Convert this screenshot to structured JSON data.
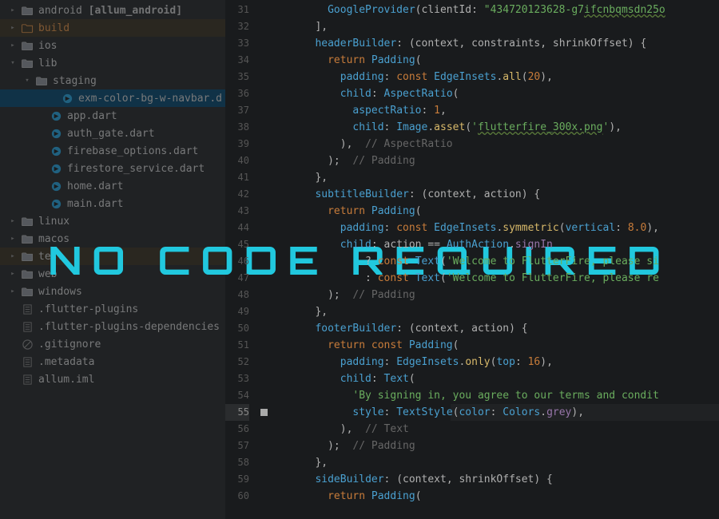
{
  "sidebar": {
    "items": [
      {
        "indent": 0,
        "chev": "right",
        "iconType": "folder",
        "label": "android",
        "suffix": " [allum_android]",
        "highlighted": false
      },
      {
        "indent": 0,
        "chev": "right",
        "iconType": "folder-excl",
        "label": "build",
        "orange": true,
        "highlighted": true
      },
      {
        "indent": 0,
        "chev": "right",
        "iconType": "folder",
        "label": "ios"
      },
      {
        "indent": 0,
        "chev": "down",
        "iconType": "folder",
        "label": "lib"
      },
      {
        "indent": 1,
        "chev": "down",
        "iconType": "folder",
        "label": "staging"
      },
      {
        "indent": 3,
        "chev": "",
        "iconType": "dart",
        "label": "exm-color-bg-w-navbar.d",
        "selected": true
      },
      {
        "indent": 2,
        "chev": "",
        "iconType": "dart",
        "label": "app.dart"
      },
      {
        "indent": 2,
        "chev": "",
        "iconType": "dart",
        "label": "auth_gate.dart"
      },
      {
        "indent": 2,
        "chev": "",
        "iconType": "dart",
        "label": "firebase_options.dart"
      },
      {
        "indent": 2,
        "chev": "",
        "iconType": "dart",
        "label": "firestore_service.dart"
      },
      {
        "indent": 2,
        "chev": "",
        "iconType": "dart",
        "label": "home.dart"
      },
      {
        "indent": 2,
        "chev": "",
        "iconType": "dart",
        "label": "main.dart"
      },
      {
        "indent": 0,
        "chev": "right",
        "iconType": "folder",
        "label": "linux"
      },
      {
        "indent": 0,
        "chev": "right",
        "iconType": "folder",
        "label": "macos"
      },
      {
        "indent": 0,
        "chev": "right",
        "iconType": "folder",
        "label": "test",
        "highlighted": true
      },
      {
        "indent": 0,
        "chev": "right",
        "iconType": "folder",
        "label": "web"
      },
      {
        "indent": 0,
        "chev": "right",
        "iconType": "folder",
        "label": "windows"
      },
      {
        "indent": 0,
        "chev": "",
        "iconType": "file",
        "label": ".flutter-plugins"
      },
      {
        "indent": 0,
        "chev": "",
        "iconType": "file",
        "label": ".flutter-plugins-dependencies"
      },
      {
        "indent": 0,
        "chev": "",
        "iconType": "ignore",
        "label": ".gitignore"
      },
      {
        "indent": 0,
        "chev": "",
        "iconType": "file",
        "label": ".metadata"
      },
      {
        "indent": 0,
        "chev": "",
        "iconType": "file",
        "label": "allum.iml"
      }
    ]
  },
  "editor": {
    "startLine": 31,
    "currentLine": 55,
    "lines": [
      {
        "n": 31,
        "tokens": [
          {
            "t": "           ",
            "c": "c-txt"
          },
          {
            "t": "GoogleProvider",
            "c": "c-type"
          },
          {
            "t": "(clientId: ",
            "c": "c-txt"
          },
          {
            "t": "\"434720123628-g7",
            "c": "c-str"
          },
          {
            "t": "ifcnbqmsdn25o",
            "c": "c-str c-wavy"
          }
        ]
      },
      {
        "n": 32,
        "tokens": [
          {
            "t": "         ],",
            "c": "c-txt"
          }
        ]
      },
      {
        "n": 33,
        "tokens": [
          {
            "t": "         ",
            "c": "c-txt"
          },
          {
            "t": "headerBuilder",
            "c": "c-param"
          },
          {
            "t": ": (context, constraints, shrinkOffset) {",
            "c": "c-txt"
          }
        ]
      },
      {
        "n": 34,
        "tokens": [
          {
            "t": "           ",
            "c": "c-txt"
          },
          {
            "t": "return ",
            "c": "c-kw"
          },
          {
            "t": "Padding",
            "c": "c-type"
          },
          {
            "t": "(",
            "c": "c-txt"
          }
        ]
      },
      {
        "n": 35,
        "tokens": [
          {
            "t": "             ",
            "c": "c-txt"
          },
          {
            "t": "padding",
            "c": "c-param"
          },
          {
            "t": ": ",
            "c": "c-txt"
          },
          {
            "t": "const ",
            "c": "c-kw"
          },
          {
            "t": "EdgeInsets",
            "c": "c-type"
          },
          {
            "t": ".",
            "c": "c-txt"
          },
          {
            "t": "all",
            "c": "c-method"
          },
          {
            "t": "(",
            "c": "c-txt"
          },
          {
            "t": "20",
            "c": "c-num"
          },
          {
            "t": "),",
            "c": "c-txt"
          }
        ]
      },
      {
        "n": 36,
        "tokens": [
          {
            "t": "             ",
            "c": "c-txt"
          },
          {
            "t": "child",
            "c": "c-param"
          },
          {
            "t": ": ",
            "c": "c-txt"
          },
          {
            "t": "AspectRatio",
            "c": "c-type"
          },
          {
            "t": "(",
            "c": "c-txt"
          }
        ]
      },
      {
        "n": 37,
        "tokens": [
          {
            "t": "               ",
            "c": "c-txt"
          },
          {
            "t": "aspectRatio",
            "c": "c-param"
          },
          {
            "t": ": ",
            "c": "c-txt"
          },
          {
            "t": "1",
            "c": "c-num"
          },
          {
            "t": ",",
            "c": "c-txt"
          }
        ]
      },
      {
        "n": 38,
        "tokens": [
          {
            "t": "               ",
            "c": "c-txt"
          },
          {
            "t": "child",
            "c": "c-param"
          },
          {
            "t": ": ",
            "c": "c-txt"
          },
          {
            "t": "Image",
            "c": "c-type"
          },
          {
            "t": ".",
            "c": "c-txt"
          },
          {
            "t": "asset",
            "c": "c-method"
          },
          {
            "t": "(",
            "c": "c-txt"
          },
          {
            "t": "'",
            "c": "c-str"
          },
          {
            "t": "flutterfire_300x.png",
            "c": "c-str c-wavy"
          },
          {
            "t": "'",
            "c": "c-str"
          },
          {
            "t": "),",
            "c": "c-txt"
          }
        ]
      },
      {
        "n": 39,
        "tokens": [
          {
            "t": "             ),  ",
            "c": "c-txt"
          },
          {
            "t": "// AspectRatio",
            "c": "c-comment"
          }
        ]
      },
      {
        "n": 40,
        "tokens": [
          {
            "t": "           );  ",
            "c": "c-txt"
          },
          {
            "t": "// Padding",
            "c": "c-comment"
          }
        ]
      },
      {
        "n": 41,
        "tokens": [
          {
            "t": "         },",
            "c": "c-txt"
          }
        ]
      },
      {
        "n": 42,
        "tokens": [
          {
            "t": "         ",
            "c": "c-txt"
          },
          {
            "t": "subtitleBuilder",
            "c": "c-param"
          },
          {
            "t": ": (context, action) {",
            "c": "c-txt"
          }
        ]
      },
      {
        "n": 43,
        "tokens": [
          {
            "t": "           ",
            "c": "c-txt"
          },
          {
            "t": "return ",
            "c": "c-kw"
          },
          {
            "t": "Padding",
            "c": "c-type"
          },
          {
            "t": "(",
            "c": "c-txt"
          }
        ]
      },
      {
        "n": 44,
        "tokens": [
          {
            "t": "             ",
            "c": "c-txt"
          },
          {
            "t": "padding",
            "c": "c-param"
          },
          {
            "t": ": ",
            "c": "c-txt"
          },
          {
            "t": "const ",
            "c": "c-kw"
          },
          {
            "t": "EdgeInsets",
            "c": "c-type"
          },
          {
            "t": ".",
            "c": "c-txt"
          },
          {
            "t": "symmetric",
            "c": "c-method"
          },
          {
            "t": "(",
            "c": "c-txt"
          },
          {
            "t": "vertical",
            "c": "c-param"
          },
          {
            "t": ": ",
            "c": "c-txt"
          },
          {
            "t": "8.0",
            "c": "c-num"
          },
          {
            "t": "),",
            "c": "c-txt"
          }
        ]
      },
      {
        "n": 45,
        "tokens": [
          {
            "t": "             ",
            "c": "c-txt"
          },
          {
            "t": "child",
            "c": "c-param"
          },
          {
            "t": ": action == ",
            "c": "c-txt"
          },
          {
            "t": "AuthAction",
            "c": "c-type"
          },
          {
            "t": ".",
            "c": "c-txt"
          },
          {
            "t": "signIn",
            "c": "c-prop"
          }
        ]
      },
      {
        "n": 46,
        "tokens": [
          {
            "t": "                 ? ",
            "c": "c-txt"
          },
          {
            "t": "const ",
            "c": "c-kw"
          },
          {
            "t": "Text",
            "c": "c-type"
          },
          {
            "t": "(",
            "c": "c-txt"
          },
          {
            "t": "'Welcome to FlutterFire, please si",
            "c": "c-str"
          }
        ]
      },
      {
        "n": 47,
        "tokens": [
          {
            "t": "                 : ",
            "c": "c-txt"
          },
          {
            "t": "const ",
            "c": "c-kw"
          },
          {
            "t": "Text",
            "c": "c-type"
          },
          {
            "t": "(",
            "c": "c-txt"
          },
          {
            "t": "'Welcome to FlutterFire, please re",
            "c": "c-str"
          }
        ]
      },
      {
        "n": 48,
        "tokens": [
          {
            "t": "           );  ",
            "c": "c-txt"
          },
          {
            "t": "// Padding",
            "c": "c-comment"
          }
        ]
      },
      {
        "n": 49,
        "tokens": [
          {
            "t": "         },",
            "c": "c-txt"
          }
        ]
      },
      {
        "n": 50,
        "tokens": [
          {
            "t": "         ",
            "c": "c-txt"
          },
          {
            "t": "footerBuilder",
            "c": "c-param"
          },
          {
            "t": ": (context, action) {",
            "c": "c-txt"
          }
        ]
      },
      {
        "n": 51,
        "tokens": [
          {
            "t": "           ",
            "c": "c-txt"
          },
          {
            "t": "return const ",
            "c": "c-kw"
          },
          {
            "t": "Padding",
            "c": "c-type"
          },
          {
            "t": "(",
            "c": "c-txt"
          }
        ]
      },
      {
        "n": 52,
        "tokens": [
          {
            "t": "             ",
            "c": "c-txt"
          },
          {
            "t": "padding",
            "c": "c-param"
          },
          {
            "t": ": ",
            "c": "c-txt"
          },
          {
            "t": "EdgeInsets",
            "c": "c-type"
          },
          {
            "t": ".",
            "c": "c-txt"
          },
          {
            "t": "only",
            "c": "c-method"
          },
          {
            "t": "(",
            "c": "c-txt"
          },
          {
            "t": "top",
            "c": "c-param"
          },
          {
            "t": ": ",
            "c": "c-txt"
          },
          {
            "t": "16",
            "c": "c-num"
          },
          {
            "t": "),",
            "c": "c-txt"
          }
        ]
      },
      {
        "n": 53,
        "tokens": [
          {
            "t": "             ",
            "c": "c-txt"
          },
          {
            "t": "child",
            "c": "c-param"
          },
          {
            "t": ": ",
            "c": "c-txt"
          },
          {
            "t": "Text",
            "c": "c-type"
          },
          {
            "t": "(",
            "c": "c-txt"
          }
        ]
      },
      {
        "n": 54,
        "tokens": [
          {
            "t": "               ",
            "c": "c-txt"
          },
          {
            "t": "'By signing in, you agree to our terms and condit",
            "c": "c-str"
          }
        ]
      },
      {
        "n": 55,
        "tokens": [
          {
            "t": "               ",
            "c": "c-txt"
          },
          {
            "t": "style",
            "c": "c-param"
          },
          {
            "t": ": ",
            "c": "c-txt"
          },
          {
            "t": "TextStyle",
            "c": "c-type"
          },
          {
            "t": "(",
            "c": "c-txt"
          },
          {
            "t": "color",
            "c": "c-param"
          },
          {
            "t": ": ",
            "c": "c-txt"
          },
          {
            "t": "Colors",
            "c": "c-type"
          },
          {
            "t": ".",
            "c": "c-txt"
          },
          {
            "t": "grey",
            "c": "c-prop"
          },
          {
            "t": "),",
            "c": "c-txt"
          }
        ]
      },
      {
        "n": 56,
        "tokens": [
          {
            "t": "             ),  ",
            "c": "c-txt"
          },
          {
            "t": "// Text",
            "c": "c-comment"
          }
        ]
      },
      {
        "n": 57,
        "tokens": [
          {
            "t": "           );  ",
            "c": "c-txt"
          },
          {
            "t": "// Padding",
            "c": "c-comment"
          }
        ]
      },
      {
        "n": 58,
        "tokens": [
          {
            "t": "         },",
            "c": "c-txt"
          }
        ]
      },
      {
        "n": 59,
        "tokens": [
          {
            "t": "         ",
            "c": "c-txt"
          },
          {
            "t": "sideBuilder",
            "c": "c-param"
          },
          {
            "t": ": (context, shrinkOffset) {",
            "c": "c-txt"
          }
        ]
      },
      {
        "n": 60,
        "tokens": [
          {
            "t": "           ",
            "c": "c-txt"
          },
          {
            "t": "return ",
            "c": "c-kw"
          },
          {
            "t": "Padding",
            "c": "c-type"
          },
          {
            "t": "(",
            "c": "c-txt"
          }
        ]
      }
    ]
  },
  "overlay": {
    "text": "No Code Required"
  }
}
